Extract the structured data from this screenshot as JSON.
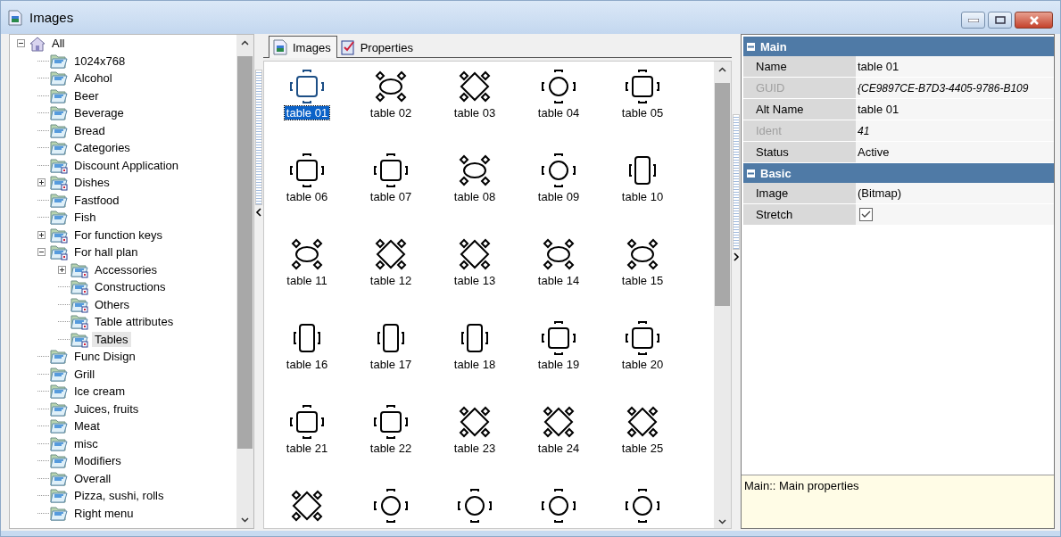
{
  "window": {
    "title": "Images"
  },
  "tree": {
    "items": [
      {
        "label": "All",
        "kind": "root",
        "expanded": true,
        "selected": false,
        "children": [
          {
            "label": "1024x768",
            "kind": "folder",
            "marked": false,
            "selected": false
          },
          {
            "label": "Alcohol",
            "kind": "folder",
            "marked": false,
            "selected": false
          },
          {
            "label": "Beer",
            "kind": "folder",
            "marked": false,
            "selected": false
          },
          {
            "label": "Beverage",
            "kind": "folder",
            "marked": false,
            "selected": false
          },
          {
            "label": "Bread",
            "kind": "folder",
            "marked": false,
            "selected": false
          },
          {
            "label": "Categories",
            "kind": "folder",
            "marked": false,
            "selected": false
          },
          {
            "label": "Discount Application",
            "kind": "folder",
            "marked": true,
            "selected": false
          },
          {
            "label": "Dishes",
            "kind": "folder",
            "marked": true,
            "expanded": false,
            "selected": false
          },
          {
            "label": "Fastfood",
            "kind": "folder",
            "marked": false,
            "selected": false
          },
          {
            "label": "Fish",
            "kind": "folder",
            "marked": false,
            "selected": false
          },
          {
            "label": "For function keys",
            "kind": "folder",
            "marked": true,
            "expanded": false,
            "selected": false
          },
          {
            "label": "For hall plan",
            "kind": "folder",
            "marked": true,
            "expanded": true,
            "selected": false,
            "children": [
              {
                "label": "Accessories",
                "kind": "folder",
                "marked": true,
                "expanded": false,
                "selected": false
              },
              {
                "label": "Constructions",
                "kind": "folder",
                "marked": true,
                "selected": false
              },
              {
                "label": "Others",
                "kind": "folder",
                "marked": true,
                "selected": false
              },
              {
                "label": "Table attributes",
                "kind": "folder",
                "marked": true,
                "selected": false
              },
              {
                "label": "Tables",
                "kind": "folder",
                "marked": true,
                "selected": true
              }
            ]
          },
          {
            "label": "Func Disign",
            "kind": "folder",
            "marked": false,
            "selected": false
          },
          {
            "label": "Grill",
            "kind": "folder",
            "marked": false,
            "selected": false
          },
          {
            "label": "Ice cream",
            "kind": "folder",
            "marked": false,
            "selected": false
          },
          {
            "label": "Juices, fruits",
            "kind": "folder",
            "marked": false,
            "selected": false
          },
          {
            "label": "Meat",
            "kind": "folder",
            "marked": false,
            "selected": false
          },
          {
            "label": "misc",
            "kind": "folder",
            "marked": false,
            "selected": false
          },
          {
            "label": "Modifiers",
            "kind": "folder",
            "marked": false,
            "selected": false
          },
          {
            "label": "Overall",
            "kind": "folder",
            "marked": false,
            "selected": false
          },
          {
            "label": "Pizza, sushi, rolls",
            "kind": "folder",
            "marked": false,
            "selected": false
          },
          {
            "label": "Right menu",
            "kind": "folder",
            "marked": false,
            "selected": false
          }
        ]
      }
    ]
  },
  "tabs": [
    {
      "label": "Images",
      "kind": "images",
      "selected": true
    },
    {
      "label": "Properties",
      "kind": "properties",
      "selected": false
    }
  ],
  "images": [
    {
      "label": "table 01",
      "kind": "square",
      "selected": true
    },
    {
      "label": "table 02",
      "kind": "oval",
      "selected": false
    },
    {
      "label": "table 03",
      "kind": "diamond",
      "selected": false
    },
    {
      "label": "table 04",
      "kind": "round",
      "selected": false
    },
    {
      "label": "table 05",
      "kind": "square",
      "selected": false
    },
    {
      "label": "table 06",
      "kind": "square",
      "selected": false
    },
    {
      "label": "table 07",
      "kind": "square",
      "selected": false
    },
    {
      "label": "table 08",
      "kind": "oval",
      "selected": false
    },
    {
      "label": "table 09",
      "kind": "round",
      "selected": false
    },
    {
      "label": "table 10",
      "kind": "rect",
      "selected": false
    },
    {
      "label": "table 11",
      "kind": "oval",
      "selected": false
    },
    {
      "label": "table 12",
      "kind": "diamond",
      "selected": false
    },
    {
      "label": "table 13",
      "kind": "diamond",
      "selected": false
    },
    {
      "label": "table 14",
      "kind": "oval",
      "selected": false
    },
    {
      "label": "table 15",
      "kind": "oval",
      "selected": false
    },
    {
      "label": "table 16",
      "kind": "rect",
      "selected": false
    },
    {
      "label": "table 17",
      "kind": "rect",
      "selected": false
    },
    {
      "label": "table 18",
      "kind": "rect",
      "selected": false
    },
    {
      "label": "table 19",
      "kind": "square",
      "selected": false
    },
    {
      "label": "table 20",
      "kind": "square",
      "selected": false
    },
    {
      "label": "table 21",
      "kind": "square",
      "selected": false
    },
    {
      "label": "table 22",
      "kind": "square",
      "selected": false
    },
    {
      "label": "table 23",
      "kind": "diamond",
      "selected": false
    },
    {
      "label": "table 24",
      "kind": "diamond",
      "selected": false
    },
    {
      "label": "table 25",
      "kind": "diamond",
      "selected": false
    },
    {
      "kind": "diamond",
      "selected": false
    },
    {
      "kind": "round",
      "selected": false
    },
    {
      "kind": "round",
      "selected": false
    },
    {
      "kind": "round",
      "selected": false
    },
    {
      "kind": "round",
      "selected": false
    }
  ],
  "properties": {
    "categories": [
      {
        "title": "Main",
        "expanded": true,
        "rows": [
          {
            "name": "Name",
            "kind": "text",
            "value": "table 01",
            "disabled": false
          },
          {
            "name": "GUID",
            "kind": "text",
            "value": "{CE9897CE-B7D3-4405-9786-B109",
            "disabled": true
          },
          {
            "name": "Alt Name",
            "kind": "text",
            "value": "table 01",
            "disabled": false
          },
          {
            "name": "Ident",
            "kind": "text",
            "value": "41",
            "disabled": true
          },
          {
            "name": "Status",
            "kind": "text",
            "value": "Active",
            "disabled": false
          }
        ]
      },
      {
        "title": "Basic",
        "expanded": true,
        "rows": [
          {
            "name": "Image",
            "kind": "text",
            "value": "(Bitmap)",
            "disabled": false
          },
          {
            "name": "Stretch",
            "kind": "checkbox",
            "checked": true,
            "disabled": false
          }
        ]
      }
    ],
    "description": "Main:: Main properties"
  }
}
